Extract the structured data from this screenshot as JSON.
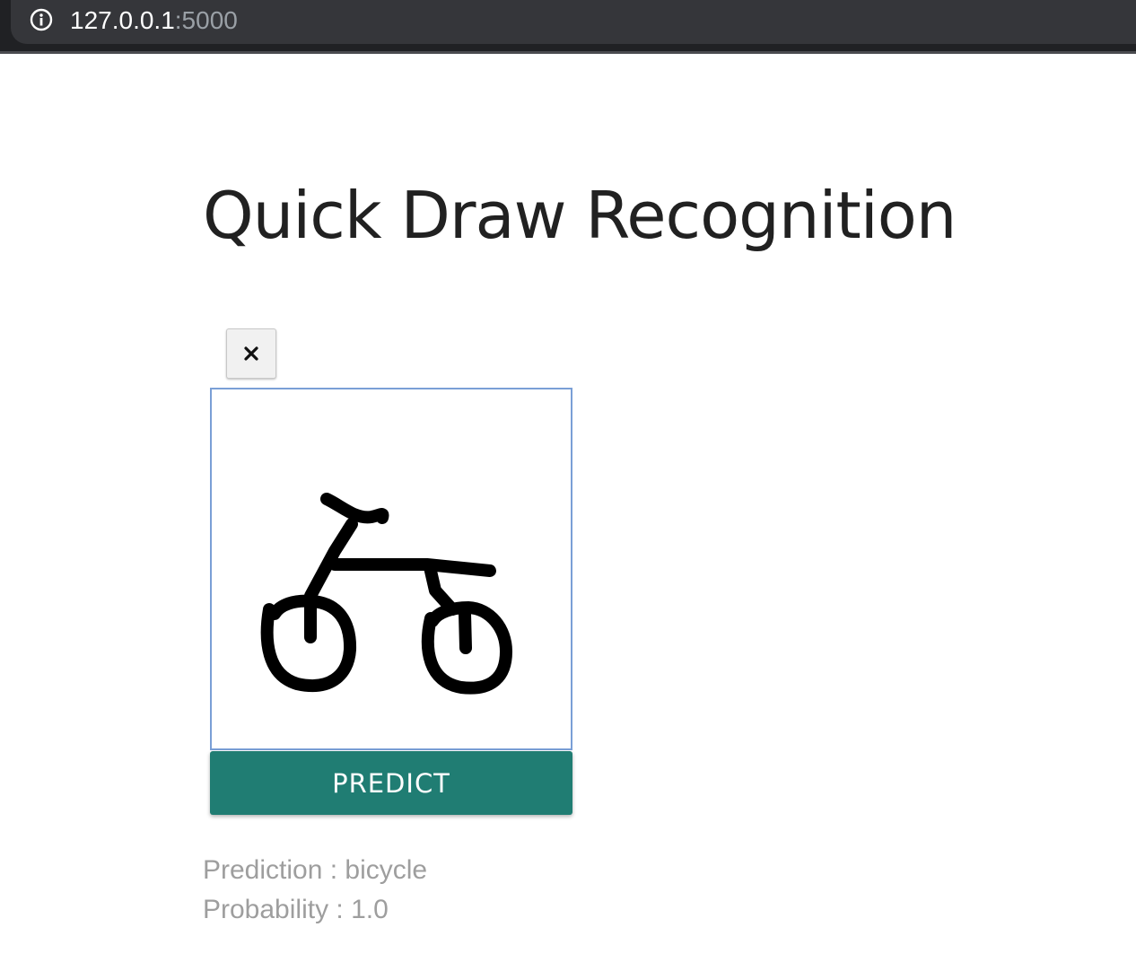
{
  "browser": {
    "url_host": "127.0.0.1",
    "url_port": ":5000",
    "address_icon": "info-icon"
  },
  "page": {
    "title": "Quick Draw Recognition"
  },
  "toolbar": {
    "clear_icon": "close-icon"
  },
  "canvas": {
    "drawing": "bicycle sketch"
  },
  "actions": {
    "predict_label": "PREDICT"
  },
  "results": {
    "prediction_label": "Prediction :",
    "prediction_value": "bicycle",
    "probability_label": "Probability :",
    "probability_value": "1.0"
  },
  "colors": {
    "predict_button": "#207d73",
    "canvas_border": "#7a9fd6",
    "result_text": "#9e9e9e",
    "browser_bar": "#202124"
  }
}
